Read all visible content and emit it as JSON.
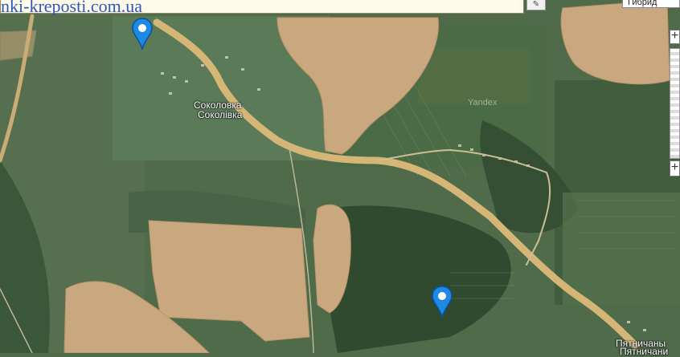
{
  "header": {
    "site_url": "nki-kreposti.com.ua"
  },
  "map_controls": {
    "edit_icon": "✎",
    "map_type_label": "Гибрид",
    "zoom_in_symbol": "+",
    "zoom_out_symbol": "+"
  },
  "map": {
    "provider_watermark": "Yandex",
    "places": [
      {
        "name_ru": "Соколовка",
        "name_uk": "Соколівка"
      },
      {
        "name_ru": "Пятничаны",
        "name_uk": "Пятничани"
      }
    ],
    "markers": [
      {
        "color": "#1e88e5"
      },
      {
        "color": "#1e88e5"
      }
    ]
  },
  "colors": {
    "field_tan": "#c9a77f",
    "road": "#d6b676",
    "vegetation": "#4c6a45",
    "dark_forest": "#2f4a2e",
    "pin_blue": "#1e88e5",
    "url_blue": "#2f56c0"
  }
}
